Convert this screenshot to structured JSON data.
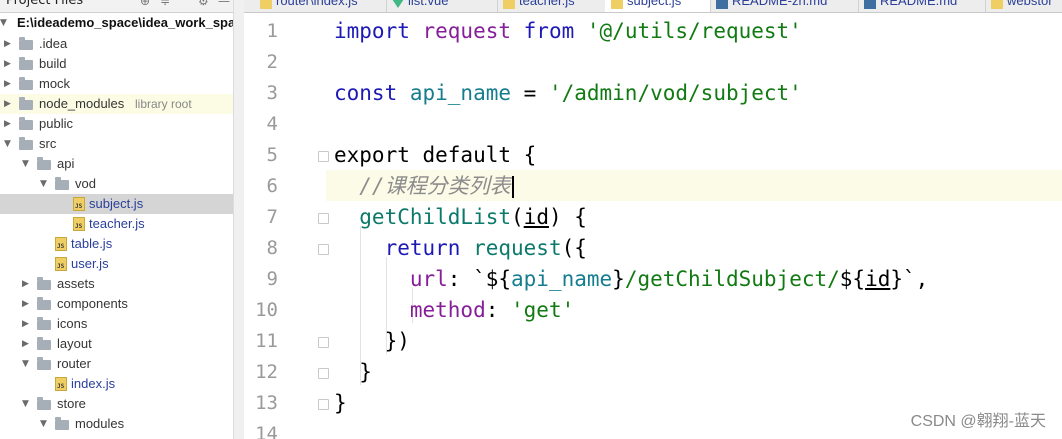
{
  "project_panel": {
    "title": "Project Files",
    "tree": [
      {
        "label": "E:\\ideademo_space\\idea_work_spa",
        "kind": "root",
        "depth": 0,
        "expanded": true
      },
      {
        "label": ".idea",
        "kind": "folder",
        "depth": 1,
        "expanded": false
      },
      {
        "label": "build",
        "kind": "folder",
        "depth": 1,
        "expanded": false
      },
      {
        "label": "mock",
        "kind": "folder",
        "depth": 1,
        "expanded": false
      },
      {
        "label": "node_modules",
        "tag": "library root",
        "kind": "folder",
        "depth": 1,
        "expanded": false
      },
      {
        "label": "public",
        "kind": "folder",
        "depth": 1,
        "expanded": false
      },
      {
        "label": "src",
        "kind": "folder",
        "depth": 1,
        "expanded": true
      },
      {
        "label": "api",
        "kind": "folder",
        "depth": 2,
        "expanded": true
      },
      {
        "label": "vod",
        "kind": "folder",
        "depth": 3,
        "expanded": true
      },
      {
        "label": "subject.js",
        "kind": "js",
        "depth": 4,
        "selected": true
      },
      {
        "label": "teacher.js",
        "kind": "js",
        "depth": 4
      },
      {
        "label": "table.js",
        "kind": "js",
        "depth": 3
      },
      {
        "label": "user.js",
        "kind": "js",
        "depth": 3
      },
      {
        "label": "assets",
        "kind": "folder",
        "depth": 2,
        "expanded": false
      },
      {
        "label": "components",
        "kind": "folder",
        "depth": 2,
        "expanded": false
      },
      {
        "label": "icons",
        "kind": "folder",
        "depth": 2,
        "expanded": false
      },
      {
        "label": "layout",
        "kind": "folder",
        "depth": 2,
        "expanded": false
      },
      {
        "label": "router",
        "kind": "folder",
        "depth": 2,
        "expanded": true
      },
      {
        "label": "index.js",
        "kind": "js",
        "depth": 3
      },
      {
        "label": "store",
        "kind": "folder",
        "depth": 2,
        "expanded": true
      },
      {
        "label": "modules",
        "kind": "folder",
        "depth": 3,
        "expanded": true
      }
    ]
  },
  "tabs": [
    {
      "label": "router\\index.js",
      "icon": "js-file-icon"
    },
    {
      "label": "list.vue",
      "icon": "vue-file-icon"
    },
    {
      "label": "teacher.js",
      "icon": "js-file-icon"
    },
    {
      "label": "subject.js",
      "icon": "js-file-icon",
      "active": true
    },
    {
      "label": "README-zh.md",
      "icon": "md-file-icon"
    },
    {
      "label": "README.md",
      "icon": "md-file-icon"
    },
    {
      "label": "webstor",
      "icon": "js-file-icon"
    }
  ],
  "editor": {
    "line_numbers": [
      "1",
      "2",
      "3",
      "4",
      "5",
      "6",
      "7",
      "8",
      "9",
      "10",
      "11",
      "12",
      "13",
      "14"
    ],
    "current_line": 6,
    "lines": [
      [
        {
          "t": "import",
          "c": "kw"
        },
        {
          "t": " request ",
          "c": "req"
        },
        {
          "t": "from",
          "c": "kw"
        },
        {
          "t": " ",
          "c": "plain"
        },
        {
          "t": "'@/utils/request'",
          "c": "str"
        }
      ],
      [],
      [
        {
          "t": "const",
          "c": "kw"
        },
        {
          "t": " api_name",
          "c": "var"
        },
        {
          "t": " = ",
          "c": "plain"
        },
        {
          "t": "'/admin/vod/subject'",
          "c": "str"
        }
      ],
      [],
      [
        {
          "t": "export default {",
          "c": "plain"
        }
      ],
      [
        {
          "t": "  //课程分类列表",
          "c": "cmt"
        }
      ],
      [
        {
          "t": "  getChildList",
          "c": "fn"
        },
        {
          "t": "(",
          "c": "plain"
        },
        {
          "t": "id",
          "c": "ul"
        },
        {
          "t": ") {",
          "c": "plain"
        }
      ],
      [
        {
          "t": "    return",
          "c": "kw"
        },
        {
          "t": " request",
          "c": "fn"
        },
        {
          "t": "({",
          "c": "plain"
        }
      ],
      [
        {
          "t": "      url",
          "c": "prop"
        },
        {
          "t": ": `${",
          "c": "plain"
        },
        {
          "t": "api_name",
          "c": "var"
        },
        {
          "t": "}",
          "c": "plain"
        },
        {
          "t": "/getChildSubject/",
          "c": "str"
        },
        {
          "t": "${",
          "c": "plain"
        },
        {
          "t": "id",
          "c": "ul"
        },
        {
          "t": "}`,",
          "c": "plain"
        }
      ],
      [
        {
          "t": "      method",
          "c": "prop"
        },
        {
          "t": ": ",
          "c": "plain"
        },
        {
          "t": "'get'",
          "c": "str"
        }
      ],
      [
        {
          "t": "    })",
          "c": "plain"
        }
      ],
      [
        {
          "t": "  }",
          "c": "plain"
        }
      ],
      [
        {
          "t": "}",
          "c": "plain"
        }
      ],
      []
    ]
  },
  "watermark": "CSDN @翱翔-蓝天",
  "colors": {
    "keyword": "#1d19b5",
    "string": "#127a12",
    "function": "#0c7a6b",
    "property": "#861e99",
    "comment": "#8c8c8c",
    "current_line": "#fcfbe8",
    "selected_row": "#d5d5d5",
    "library_root_row": "#fbfce3"
  }
}
